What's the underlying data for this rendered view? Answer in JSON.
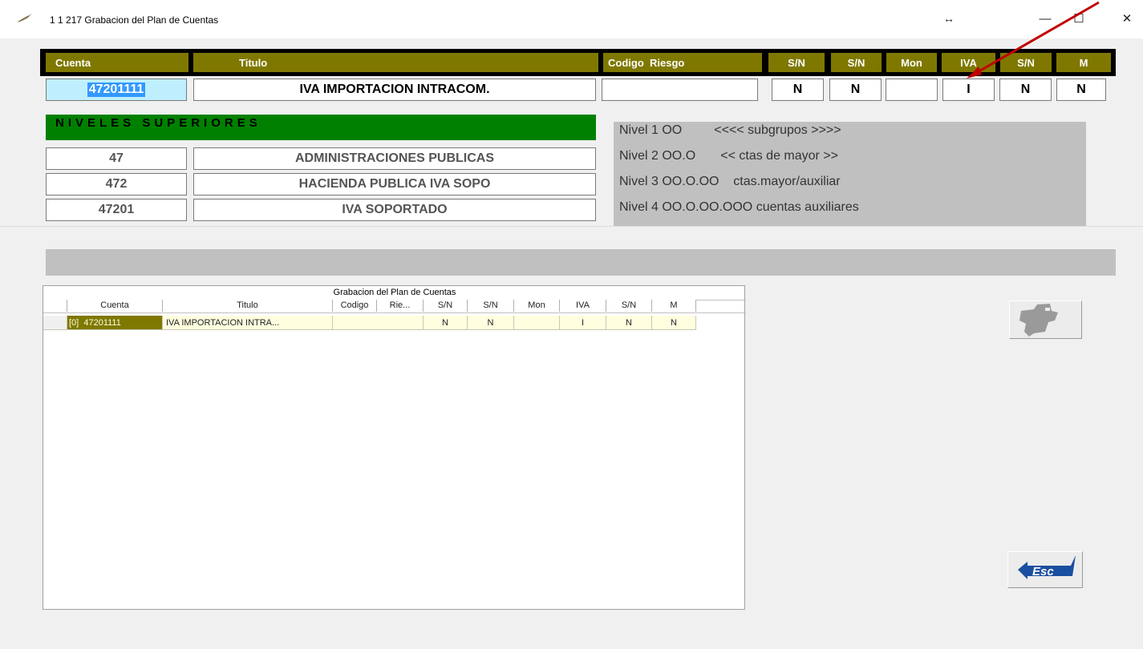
{
  "window": {
    "title": "1 1 217  Grabacion del Plan de Cuentas",
    "move_glyph": "↔",
    "minimize_glyph": "—",
    "maximize_glyph": "☐",
    "close_glyph": "✕"
  },
  "header": {
    "cuenta": "Cuenta",
    "titulo": "Titulo",
    "codigo_riesgo": "Codigo  Riesgo",
    "sn1": "S/N",
    "sn2": "S/N",
    "mon": "Mon",
    "iva": "IVA",
    "sn3": "S/N",
    "m": "M"
  },
  "entry": {
    "cuenta": "47201111",
    "titulo": "IVA IMPORTACION INTRACOM.",
    "codigo_riesgo": "",
    "sn1": "N",
    "sn2": "N",
    "mon": "",
    "iva": "I",
    "sn3": "N",
    "m": "N"
  },
  "niveles": {
    "banner": "NIVELES SUPERIORES",
    "rows": [
      {
        "codigo": "47",
        "titulo": "ADMINISTRACIONES PUBLICAS"
      },
      {
        "codigo": "472",
        "titulo": "HACIENDA PUBLICA IVA SOPO"
      },
      {
        "codigo": "47201",
        "titulo": "IVA SOPORTADO"
      }
    ]
  },
  "info_panel": {
    "lines": [
      "Nivel 1 OO         <<<< subgrupos >>>>",
      "Nivel 2 OO.O       << ctas de mayor >>",
      "Nivel 3 OO.O.OO    ctas.mayor/auxiliar",
      "Nivel 4 OO.O.OO.OOO cuentas auxiliares"
    ]
  },
  "grid": {
    "caption": "Grabacion del Plan de Cuentas",
    "columns": [
      "Cuenta",
      "Titulo",
      "Codigo",
      "Rie...",
      "S/N",
      "S/N",
      "Mon",
      "IVA",
      "S/N",
      "M"
    ],
    "rows": [
      {
        "cuenta": "[0]  47201111",
        "titulo": "IVA IMPORTACION INTRA...",
        "codigo": "",
        "sn1": "N",
        "sn2": "N",
        "mon": "",
        "iva": "I",
        "sn3": "N",
        "m": "N"
      }
    ]
  },
  "buttons": {
    "map": "map-button",
    "esc": "Esc"
  },
  "colors": {
    "header_bg": "#7f7800",
    "niveles_bg": "#008000",
    "panel_bg": "#c0c0c0",
    "cuenta_bg": "#bfefff",
    "annotation_arrow": "#c00000"
  }
}
